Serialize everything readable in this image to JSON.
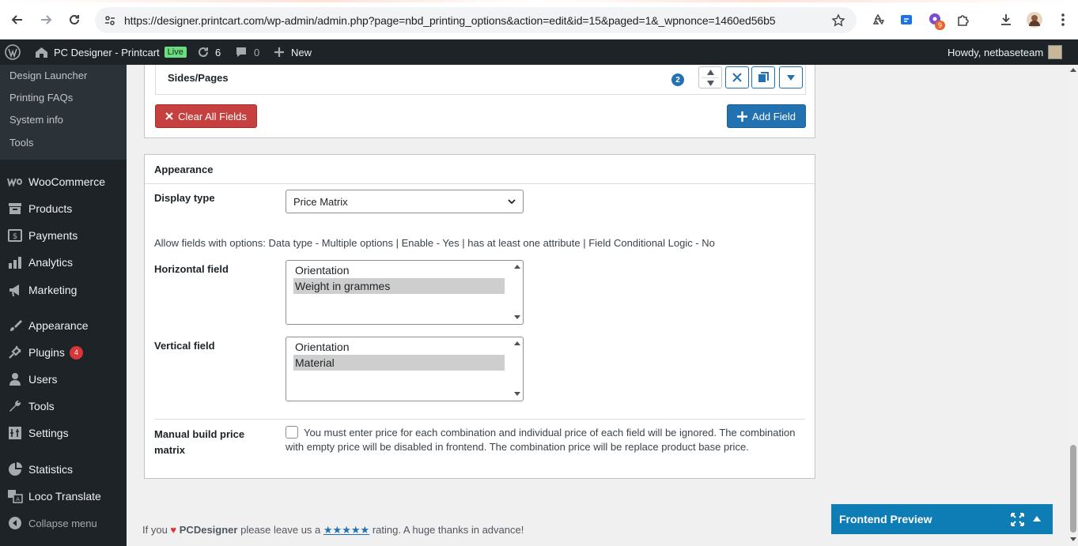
{
  "browser": {
    "url": "https://designer.printcart.com/wp-admin/admin.php?page=nbd_printing_options&action=edit&id=15&paged=1&_wpnonce=1460ed56b5",
    "extension_badge": "9"
  },
  "adminbar": {
    "site_name": "PC Designer - Printcart",
    "live_label": "Live",
    "updates_count": "6",
    "comments_count": "0",
    "new_label": "New",
    "howdy": "Howdy, netbaseteam"
  },
  "sidebar": {
    "submenu": [
      {
        "label": "Design Launcher"
      },
      {
        "label": "Printing FAQs"
      },
      {
        "label": "System info"
      },
      {
        "label": "Tools"
      }
    ],
    "menu": [
      {
        "label": "WooCommerce",
        "icon": "woo-icon"
      },
      {
        "label": "Products",
        "icon": "archive-icon"
      },
      {
        "label": "Payments",
        "icon": "payments-icon"
      },
      {
        "label": "Analytics",
        "icon": "bar-chart-icon"
      },
      {
        "label": "Marketing",
        "icon": "megaphone-icon"
      },
      {
        "label": "Appearance",
        "icon": "brush-icon"
      },
      {
        "label": "Plugins",
        "icon": "plug-icon",
        "count": "4"
      },
      {
        "label": "Users",
        "icon": "user-icon"
      },
      {
        "label": "Tools",
        "icon": "wrench-icon"
      },
      {
        "label": "Settings",
        "icon": "settings-icon"
      },
      {
        "label": "Statistics",
        "icon": "pie-chart-icon"
      },
      {
        "label": "Loco Translate",
        "icon": "translate-icon"
      },
      {
        "label": "Collapse menu",
        "icon": "collapse-icon"
      }
    ]
  },
  "fields": {
    "row_label": "Sides/Pages",
    "row_badge": "2",
    "clear_label": "Clear All Fields",
    "add_label": "Add Field"
  },
  "appearance": {
    "title": "Appearance",
    "display_type_label": "Display type",
    "display_type_value": "Price Matrix",
    "help": "Allow fields with options: Data type - Multiple options | Enable - Yes | has at least one attribute | Field Conditional Logic - No",
    "horizontal_label": "Horizontal field",
    "horizontal_options": [
      "Orientation",
      "Weight in grammes"
    ],
    "vertical_label": "Vertical field",
    "vertical_options": [
      "Orientation",
      "Material"
    ],
    "manual_label_1": "Manual build price",
    "manual_label_2": "matrix",
    "manual_text": "You must enter price for each combination and individual price of each field will be ignored. The combination with empty price will be disabled in frontend. The combination price will be replace product base price."
  },
  "footer": {
    "prefix": "If you",
    "brand": "PCDesigner",
    "middle": "please leave us a",
    "stars": "★★★★★",
    "suffix": "rating. A huge thanks in advance!"
  },
  "preview": {
    "label": "Frontend Preview"
  },
  "colors": {
    "accent": "#2271b1",
    "danger": "#c64040",
    "sidebar_bg": "#1d2327",
    "preview_bg": "#0e7cb5"
  }
}
